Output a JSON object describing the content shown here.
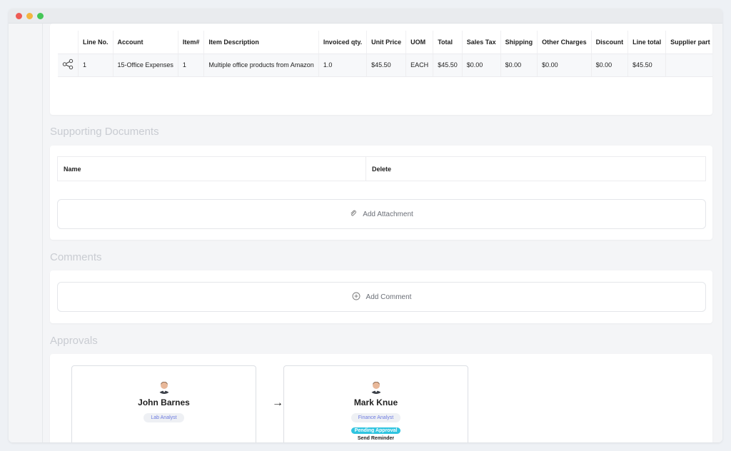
{
  "window": {
    "dots": [
      "#ee5b55",
      "#f3b53f",
      "#45c657"
    ]
  },
  "line_items": {
    "columns": [
      "",
      "Line No.",
      "Account",
      "Item#",
      "Item Description",
      "Invoiced qty.",
      "Unit Price",
      "UOM",
      "Total",
      "Sales Tax",
      "Shipping",
      "Other Charges",
      "Discount",
      "Line total",
      "Supplier part"
    ],
    "rows": [
      [
        "share-icon",
        "1",
        "15-Office Expenses",
        "1",
        "Multiple office products from Amazon",
        "1.0",
        "$45.50",
        "EACH",
        "$45.50",
        "$0.00",
        "$0.00",
        "$0.00",
        "$0.00",
        "$45.50",
        ""
      ]
    ]
  },
  "supporting_documents": {
    "title": "Supporting Documents",
    "columns": [
      "Name",
      "Delete"
    ],
    "add_label": "Add Attachment"
  },
  "comments": {
    "title": "Comments",
    "add_label": "Add Comment"
  },
  "approvals": {
    "title": "Approvals",
    "approvers": [
      {
        "name": "John Barnes",
        "role": "Lab Analyst"
      },
      {
        "name": "Mark Knue",
        "role": "Finance Analyst",
        "status": "Pending Approval",
        "action": "Send Reminder"
      }
    ],
    "arrow": "→"
  }
}
